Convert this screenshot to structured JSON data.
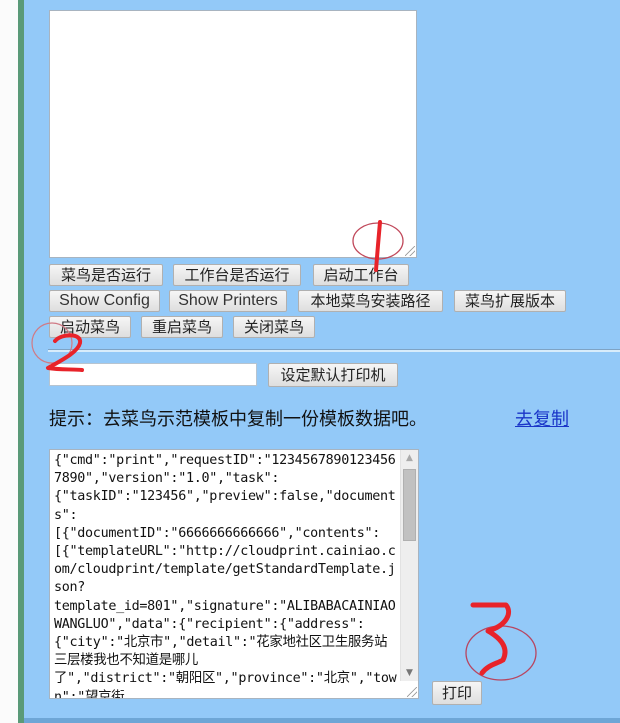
{
  "page": {
    "buttons_row1": [
      "菜鸟是否运行",
      "工作台是否运行",
      "启动工作台"
    ],
    "buttons_row2": [
      "Show Config",
      "Show Printers",
      "本地菜鸟安装路径",
      "菜鸟扩展版本"
    ],
    "buttons_row3": [
      "启动菜鸟",
      "重启菜鸟",
      "关闭菜鸟"
    ],
    "printer_input": {
      "value": "",
      "placeholder": ""
    },
    "set_default_printer_label": "设定默认打印机",
    "hint_text": "提示：去菜鸟示范模板中复制一份模板数据吧。",
    "copy_link_label": "去复制",
    "json_textarea_value": "{\"cmd\":\"print\",\"requestID\":\"12345678901234567890\",\"version\":\"1.0\",\"task\":\n{\"taskID\":\"123456\",\"preview\":false,\"documents\":\n[{\"documentID\":\"6666666666666\",\"contents\":\n[{\"templateURL\":\"http://cloudprint.cainiao.com/cloudprint/template/getStandardTemplate.json?\ntemplate_id=801\",\"signature\":\"ALIBABACAINIAOWANGLUO\",\"data\":{\"recipient\":{\"address\":\n{\"city\":\"北京市\",\"detail\":\"花家地社区卫生服务站三层楼我也不知道是哪儿\n了\",\"district\":\"朝阳区\",\"province\":\"北京\",\"town\":\"望京街",
    "print_button_label": "打印",
    "scrollbar_position": 0.0
  },
  "annotations": {
    "labels": [
      "1",
      "2",
      "3"
    ],
    "color": "#e8232a"
  }
}
